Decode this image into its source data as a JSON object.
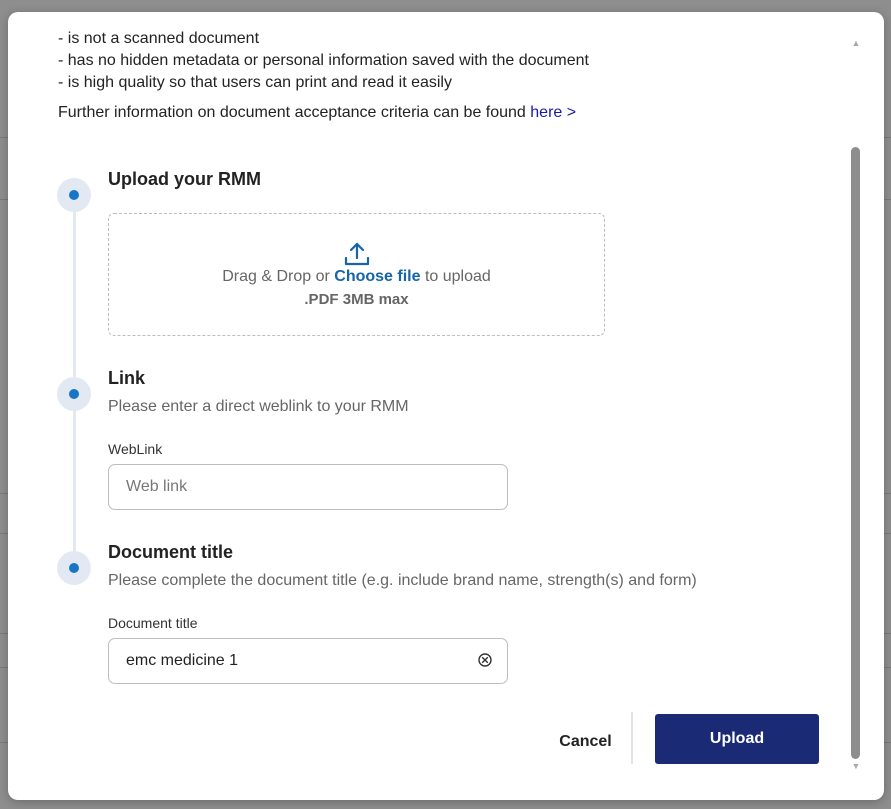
{
  "criteria": {
    "items": [
      "- is not a scanned document",
      "- has no hidden metadata or personal information saved with the document",
      "- is high quality so that users can print and read it easily"
    ],
    "further_text": "Further information on document acceptance criteria can be found ",
    "further_link": "here >"
  },
  "steps": {
    "upload": {
      "title": "Upload your RMM",
      "drag_text": "Drag & Drop or ",
      "choose_file": "Choose file",
      "to_upload": " to upload",
      "max": ".PDF 3MB max"
    },
    "link": {
      "title": "Link",
      "subtitle": "Please enter a direct weblink to your RMM",
      "field_label": "WebLink",
      "placeholder": "Web link",
      "value": ""
    },
    "document_title": {
      "title": "Document title",
      "subtitle": "Please complete the document title (e.g. include brand name, strength(s) and form)",
      "field_label": "Document title",
      "value": "emc medicine 1"
    }
  },
  "actions": {
    "cancel": "Cancel",
    "upload": "Upload"
  },
  "colors": {
    "primary_button": "#1b2a75",
    "link": "#1565a8",
    "step_dot": "#1976c5"
  }
}
